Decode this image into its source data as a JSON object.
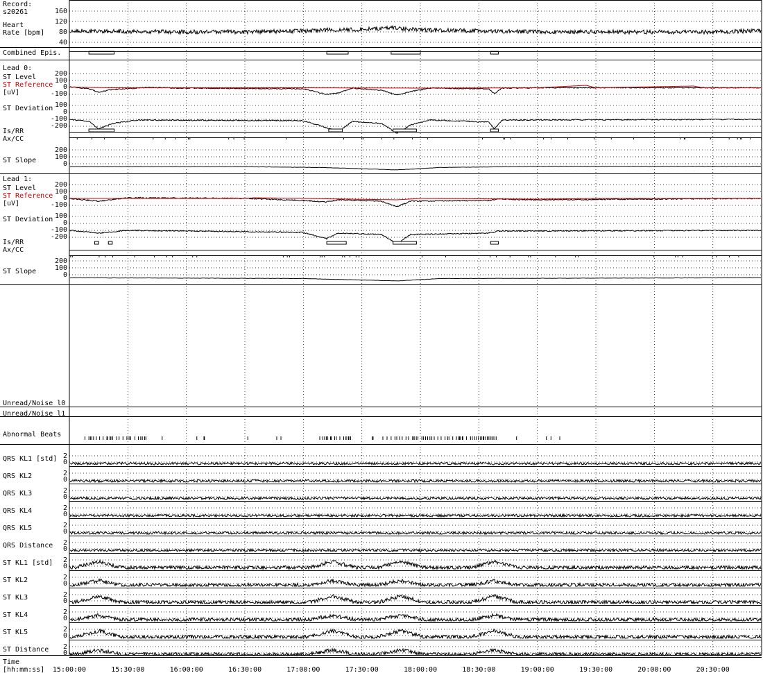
{
  "record": {
    "label": "Record:",
    "id": "s20261"
  },
  "time_axis": {
    "label_line1": "Time",
    "label_line2": "[hh:mm:ss]",
    "ticks": [
      "15:00:00",
      "15:30:00",
      "16:00:00",
      "16:30:00",
      "17:00:00",
      "17:30:00",
      "18:00:00",
      "18:30:00",
      "19:00:00",
      "19:30:00",
      "20:00:00",
      "20:30:00"
    ]
  },
  "colors": {
    "trace": "#000000",
    "reference": "#cc0000",
    "grid": "#000000"
  },
  "heart_rate": {
    "label_line1": "Heart",
    "label_line2": "Rate [bpm]",
    "ticks": [
      "160",
      "120",
      "80",
      "40"
    ]
  },
  "combined_episodes": {
    "label": "Combined Epis."
  },
  "lead0": {
    "title": "Lead 0:",
    "st_level_label": "ST Level",
    "st_reference_label": "ST Reference",
    "unit_label": "[uV]",
    "st_level_ticks": [
      "200",
      "100",
      "0",
      "-100"
    ],
    "st_deviation_label": "ST Deviation",
    "st_deviation_ticks": [
      "100",
      "0",
      "-100",
      "-200"
    ],
    "is_rr_label": "Is/RR",
    "ax_cc_label": "Ax/CC",
    "st_slope_label": "ST Slope",
    "st_slope_ticks": [
      "200",
      "100",
      "0"
    ]
  },
  "lead1": {
    "title": "Lead 1:",
    "st_level_label": "ST Level",
    "st_reference_label": "ST Reference",
    "unit_label": "[uV]",
    "st_level_ticks": [
      "200",
      "100",
      "0",
      "-100"
    ],
    "st_deviation_label": "ST Deviation",
    "st_deviation_ticks": [
      "100",
      "0",
      "-100",
      "-200"
    ],
    "is_rr_label": "Is/RR",
    "ax_cc_label": "Ax/CC",
    "st_slope_label": "ST Slope",
    "st_slope_ticks": [
      "200",
      "100",
      "0"
    ]
  },
  "unread_noise_0": {
    "label": "Unread/Noise l0"
  },
  "unread_noise_1": {
    "label": "Unread/Noise l1"
  },
  "abnormal_beats": {
    "label": "Abnormal Beats"
  },
  "kl_rows": [
    {
      "label": "QRS KL1 [std]",
      "ticks": [
        "2",
        "0"
      ]
    },
    {
      "label": "QRS KL2",
      "ticks": [
        "2",
        "0"
      ]
    },
    {
      "label": "QRS KL3",
      "ticks": [
        "2",
        "0"
      ]
    },
    {
      "label": "QRS KL4",
      "ticks": [
        "2",
        "0"
      ]
    },
    {
      "label": "QRS KL5",
      "ticks": [
        "2",
        "0"
      ]
    },
    {
      "label": "QRS Distance",
      "ticks": [
        "2",
        "0"
      ]
    },
    {
      "label": "ST KL1 [std]",
      "ticks": [
        "2",
        "0"
      ]
    },
    {
      "label": "ST KL2",
      "ticks": [
        "2",
        "0"
      ]
    },
    {
      "label": "ST KL3",
      "ticks": [
        "2",
        "0"
      ]
    },
    {
      "label": "ST KL4",
      "ticks": [
        "2",
        "0"
      ]
    },
    {
      "label": "ST KL5",
      "ticks": [
        "2",
        "0"
      ]
    },
    {
      "label": "ST Distance",
      "ticks": [
        "2",
        "0"
      ]
    }
  ],
  "chart_data": {
    "type": "line",
    "x_unit": "time [hh:mm:ss]",
    "x_range": [
      "15:00:00",
      "20:55:00"
    ],
    "episodes": {
      "combined": [
        [
          "15:10:00",
          "15:23:00"
        ],
        [
          "17:12:00",
          "17:23:00"
        ],
        [
          "17:45:00",
          "18:00:00"
        ],
        [
          "18:36:00",
          "18:40:00"
        ]
      ],
      "lead0": [
        [
          "15:10:00",
          "15:23:00"
        ],
        [
          "17:13:00",
          "17:20:00"
        ],
        [
          "17:46:00",
          "17:58:00"
        ],
        [
          "18:36:00",
          "18:40:00"
        ]
      ],
      "lead1": [
        [
          "15:13:00",
          "15:15:00"
        ],
        [
          "15:20:00",
          "15:22:00"
        ],
        [
          "17:12:00",
          "17:22:00"
        ],
        [
          "17:46:00",
          "17:58:00"
        ],
        [
          "18:36:00",
          "18:40:00"
        ]
      ]
    },
    "series": [
      {
        "name": "Heart Rate [bpm]",
        "ylim": [
          40,
          160
        ],
        "points": [
          [
            "15:00:00",
            84
          ],
          [
            "15:30:00",
            82
          ],
          [
            "16:00:00",
            80
          ],
          [
            "16:30:00",
            80
          ],
          [
            "17:00:00",
            84
          ],
          [
            "17:15:00",
            88
          ],
          [
            "17:30:00",
            90
          ],
          [
            "17:45:00",
            96
          ],
          [
            "18:00:00",
            88
          ],
          [
            "18:30:00",
            84
          ],
          [
            "19:00:00",
            80
          ],
          [
            "19:30:00",
            80
          ],
          [
            "20:00:00",
            80
          ],
          [
            "20:30:00",
            80
          ],
          [
            "20:55:00",
            84
          ]
        ]
      },
      {
        "name": "Lead 0 ST Level [uV]",
        "ylim": [
          -200,
          200
        ],
        "points": [
          [
            "15:00:00",
            10
          ],
          [
            "15:10:00",
            -20
          ],
          [
            "15:15:00",
            -70
          ],
          [
            "15:22:00",
            -30
          ],
          [
            "15:40:00",
            0
          ],
          [
            "16:00:00",
            -10
          ],
          [
            "17:00:00",
            -20
          ],
          [
            "17:12:00",
            -100
          ],
          [
            "17:18:00",
            -80
          ],
          [
            "17:25:00",
            -10
          ],
          [
            "17:40:00",
            -40
          ],
          [
            "17:48:00",
            -110
          ],
          [
            "17:55:00",
            -60
          ],
          [
            "18:05:00",
            -10
          ],
          [
            "18:35:00",
            -20
          ],
          [
            "18:38:00",
            -90
          ],
          [
            "18:42:00",
            -10
          ],
          [
            "19:00:00",
            -5
          ],
          [
            "20:55:00",
            -5
          ]
        ]
      },
      {
        "name": "Lead 0 ST Reference [uV]",
        "ylim": [
          -200,
          200
        ],
        "points": [
          [
            "15:00:00",
            5
          ],
          [
            "15:20:00",
            -5
          ],
          [
            "16:00:00",
            -5
          ],
          [
            "17:00:00",
            -5
          ],
          [
            "18:00:00",
            -10
          ],
          [
            "19:00:00",
            -5
          ],
          [
            "19:25:00",
            30
          ],
          [
            "19:30:00",
            -5
          ],
          [
            "20:20:00",
            20
          ],
          [
            "20:25:00",
            -5
          ],
          [
            "20:55:00",
            -5
          ]
        ]
      },
      {
        "name": "Lead 0 ST Deviation [uV]",
        "ylim": [
          -200,
          200
        ],
        "points": [
          [
            "15:00:00",
            0
          ],
          [
            "15:10:00",
            -30
          ],
          [
            "15:15:00",
            -140
          ],
          [
            "15:22:00",
            -60
          ],
          [
            "15:35:00",
            -10
          ],
          [
            "17:00:00",
            -20
          ],
          [
            "17:12:00",
            -120
          ],
          [
            "17:18:00",
            -180
          ],
          [
            "17:25:00",
            -30
          ],
          [
            "17:40:00",
            -60
          ],
          [
            "17:48:00",
            -200
          ],
          [
            "17:55:00",
            -80
          ],
          [
            "18:05:00",
            -10
          ],
          [
            "18:35:00",
            -40
          ],
          [
            "18:38:00",
            -140
          ],
          [
            "18:42:00",
            -10
          ],
          [
            "20:55:00",
            0
          ]
        ]
      },
      {
        "name": "Lead 0 ST Slope",
        "ylim": [
          -50,
          300
        ],
        "points": [
          [
            "15:00:00",
            0
          ],
          [
            "16:30:00",
            0
          ],
          [
            "17:10:00",
            -10
          ],
          [
            "17:48:00",
            -40
          ],
          [
            "18:10:00",
            -10
          ],
          [
            "19:00:00",
            5
          ],
          [
            "20:55:00",
            5
          ]
        ]
      },
      {
        "name": "Lead 1 ST Level [uV]",
        "ylim": [
          -200,
          200
        ],
        "points": [
          [
            "15:00:00",
            0
          ],
          [
            "15:15:00",
            -40
          ],
          [
            "15:30:00",
            10
          ],
          [
            "16:30:00",
            0
          ],
          [
            "17:00:00",
            -30
          ],
          [
            "17:12:00",
            -50
          ],
          [
            "17:18:00",
            -20
          ],
          [
            "17:40:00",
            -40
          ],
          [
            "17:48:00",
            -120
          ],
          [
            "17:55:00",
            -40
          ],
          [
            "18:35:00",
            -30
          ],
          [
            "18:40:00",
            -10
          ],
          [
            "19:00:00",
            -20
          ],
          [
            "20:55:00",
            0
          ]
        ]
      },
      {
        "name": "Lead 1 ST Reference [uV]",
        "ylim": [
          -200,
          200
        ],
        "points": [
          [
            "15:00:00",
            0
          ],
          [
            "16:30:00",
            0
          ],
          [
            "16:35:00",
            10
          ],
          [
            "17:00:00",
            0
          ],
          [
            "17:48:00",
            -20
          ],
          [
            "18:00:00",
            0
          ],
          [
            "19:00:00",
            -10
          ],
          [
            "19:30:00",
            0
          ],
          [
            "20:55:00",
            0
          ]
        ]
      },
      {
        "name": "Lead 1 ST Deviation [uV]",
        "ylim": [
          -200,
          200
        ],
        "points": [
          [
            "15:00:00",
            0
          ],
          [
            "15:15:00",
            -40
          ],
          [
            "15:30:00",
            0
          ],
          [
            "17:00:00",
            -30
          ],
          [
            "17:12:00",
            -120
          ],
          [
            "17:18:00",
            -40
          ],
          [
            "17:40:00",
            -60
          ],
          [
            "17:48:00",
            -190
          ],
          [
            "17:55:00",
            -60
          ],
          [
            "18:35:00",
            -40
          ],
          [
            "18:40:00",
            -10
          ],
          [
            "20:55:00",
            0
          ]
        ]
      },
      {
        "name": "Lead 1 ST Slope",
        "ylim": [
          -50,
          300
        ],
        "points": [
          [
            "15:00:00",
            0
          ],
          [
            "17:00:00",
            -10
          ],
          [
            "17:48:00",
            -40
          ],
          [
            "18:10:00",
            -10
          ],
          [
            "20:55:00",
            0
          ]
        ]
      }
    ]
  }
}
